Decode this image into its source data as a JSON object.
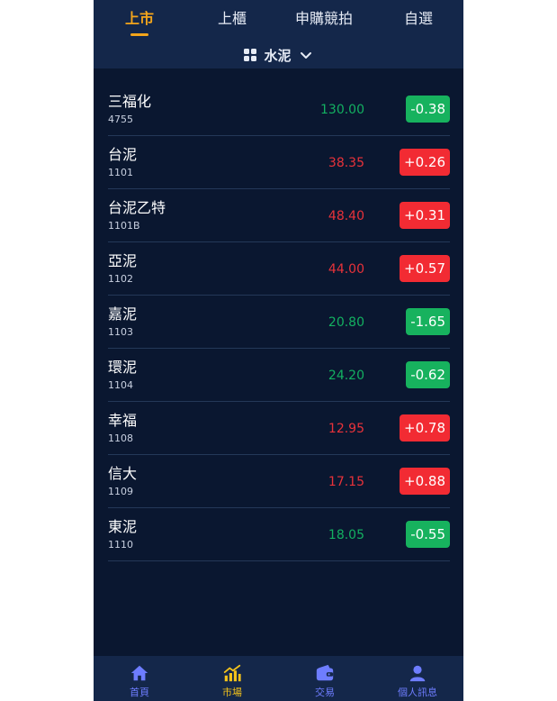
{
  "tabs": [
    {
      "label": "上市",
      "active": true
    },
    {
      "label": "上櫃",
      "active": false
    },
    {
      "label": "申購競拍",
      "active": false
    },
    {
      "label": "自選",
      "active": false
    }
  ],
  "category": {
    "label": "水泥",
    "icon": "grid-icon",
    "dropdown_icon": "chevron-down-icon"
  },
  "stocks": [
    {
      "name": "三福化",
      "code": "4755",
      "price": "130.00",
      "change": "-0.38",
      "direction": "down"
    },
    {
      "name": "台泥",
      "code": "1101",
      "price": "38.35",
      "change": "+0.26",
      "direction": "up"
    },
    {
      "name": "台泥乙特",
      "code": "1101B",
      "price": "48.40",
      "change": "+0.31",
      "direction": "up"
    },
    {
      "name": "亞泥",
      "code": "1102",
      "price": "44.00",
      "change": "+0.57",
      "direction": "up"
    },
    {
      "name": "嘉泥",
      "code": "1103",
      "price": "20.80",
      "change": "-1.65",
      "direction": "down"
    },
    {
      "name": "環泥",
      "code": "1104",
      "price": "24.20",
      "change": "-0.62",
      "direction": "down"
    },
    {
      "name": "幸福",
      "code": "1108",
      "price": "12.95",
      "change": "+0.78",
      "direction": "up"
    },
    {
      "name": "信大",
      "code": "1109",
      "price": "17.15",
      "change": "+0.88",
      "direction": "up"
    },
    {
      "name": "東泥",
      "code": "1110",
      "price": "18.05",
      "change": "-0.55",
      "direction": "down"
    }
  ],
  "nav": [
    {
      "label": "首頁",
      "icon": "home-icon",
      "active": false
    },
    {
      "label": "市場",
      "icon": "chart-icon",
      "active": true
    },
    {
      "label": "交易",
      "icon": "wallet-icon",
      "active": false
    },
    {
      "label": "個人訊息",
      "icon": "user-icon",
      "active": false
    }
  ],
  "colors": {
    "background": "#0a1730",
    "header": "#14274a",
    "accent": "#f3a51b",
    "up": "#f22b33",
    "down": "#17b25e",
    "nav_inactive": "#6e7dff"
  }
}
